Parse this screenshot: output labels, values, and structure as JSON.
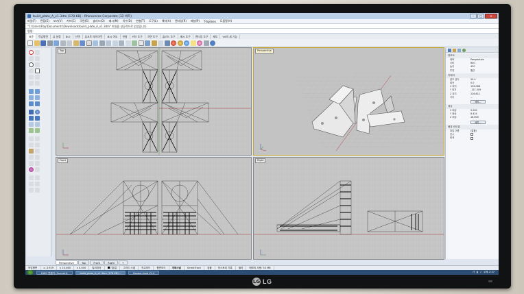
{
  "window": {
    "title": "build_plate_A_v1.3dm (178 KB) - Rhinoceros Corporate (32 비트)",
    "min": "–",
    "max": "□",
    "close": "✕"
  },
  "menu": [
    "파일(F)",
    "편집(E)",
    "보기(V)",
    "커브(C)",
    "곡면(S)",
    "솔리드(O)",
    "메시(M)",
    "치수(D)",
    "변형(T)",
    "도구(L)",
    "해석(A)",
    "렌더링(R)",
    "패널(P)",
    "T-Splines",
    "도움말(H)"
  ],
  "command": {
    "history": "\"C:\\Users\\Ray\\Documents\\Downloads\\build_plate_A_v1.3dm\" 파일을 성공적으로 읽었습니다",
    "prompt": "명령:"
  },
  "tabs": [
    "표준",
    "작업평면",
    "뷰 설정",
    "표시",
    "선택",
    "뷰포트 레이아웃",
    "표시 여부",
    "변형",
    "커브 도구",
    "곡면 도구",
    "솔리드 도구",
    "메시 도구",
    "렌더링 도구",
    "제도",
    "V6의 새 기능"
  ],
  "viewports": {
    "top": "Top",
    "perspective": "Perspective",
    "front": "Front",
    "right": "Right"
  },
  "vtabs": [
    "Perspective",
    "Top",
    "Front",
    "Right"
  ],
  "properties": {
    "sections": {
      "view": "뷰포트",
      "camera": "카메라",
      "target": "대상",
      "wallpaper": "배경 비트맵"
    },
    "view_rows": [
      [
        "제목",
        "Perspective"
      ],
      [
        "너비",
        "840"
      ],
      [
        "높이",
        "420"
      ],
      [
        "투영",
        "원근"
      ]
    ],
    "camera_rows": [
      [
        "렌즈 길이",
        "50.0"
      ],
      [
        "회전",
        "0.0"
      ],
      [
        "X 위치",
        "196.068"
      ],
      [
        "Y 위치",
        "-121.509"
      ],
      [
        "Z 위치",
        "226.611"
      ],
      [
        "거리",
        "..."
      ]
    ],
    "target_rows": [
      [
        "X 대상",
        "5.000"
      ],
      [
        "Y 대상",
        "8.424"
      ],
      [
        "Z 대상",
        "16.600"
      ]
    ],
    "wallpaper_rows": [
      [
        "파일 이름",
        "(없음)"
      ],
      [
        "표시",
        ""
      ],
      [
        "회색",
        ""
      ]
    ],
    "place_button": "배치...",
    "target_button": "배치..."
  },
  "status": {
    "cplane": "작업평면",
    "x": "x -3.929",
    "y": "y 14.460",
    "z": "z 0.000",
    "unit": "밀리미터",
    "layer": "기본값",
    "grid_snap": "그리드 스냅",
    "ortho": "직교모드",
    "planar": "평면모드",
    "osnap": "개체스냅",
    "smarttrack": "SmartTrack",
    "gumball": "검볼",
    "record": "히스토리 기록",
    "filter": "필터",
    "memory": "메모리 사용: 53 MB"
  },
  "taskbar": {
    "tasks": [
      "DWG 변환기 (FormArt)",
      "build_plate_A_v1.3dm (178 KB)...",
      "Reader-Hold V1.0"
    ],
    "time": "오후 2:37",
    "lang": "가"
  }
}
